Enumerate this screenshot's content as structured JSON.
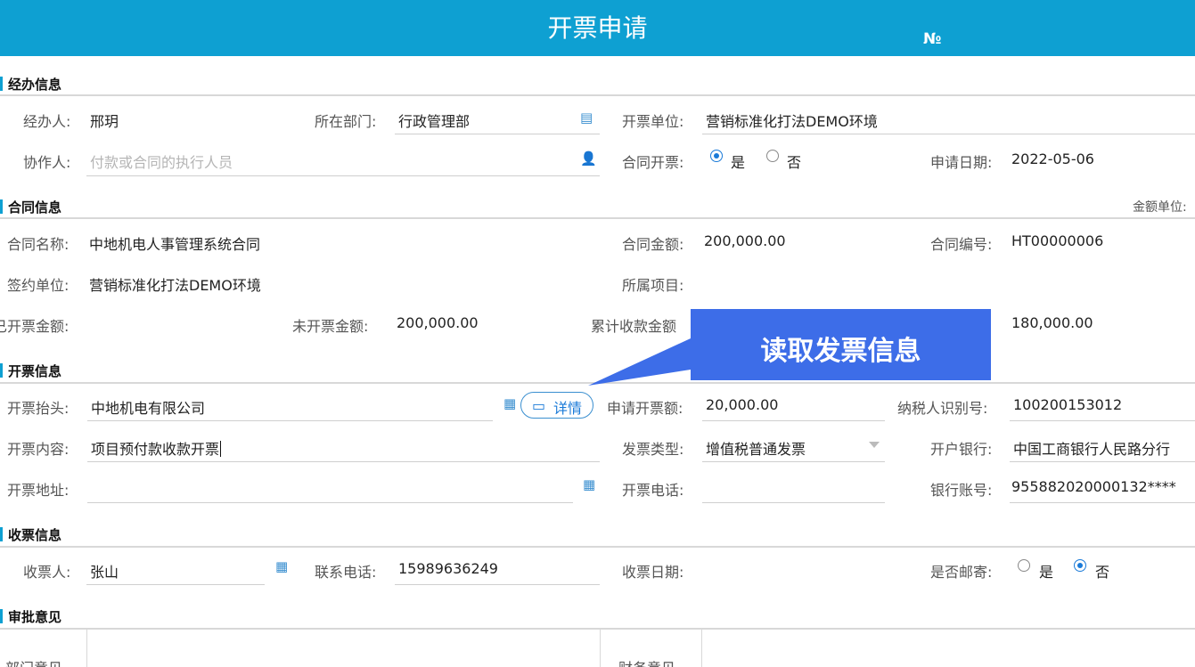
{
  "header": {
    "title": "开票申请",
    "no": "№"
  },
  "sections": {
    "handler": "经办信息",
    "contract": "合同信息",
    "invoice": "开票信息",
    "receive": "收票信息",
    "approval": "审批意见"
  },
  "handler": {
    "handler_label": "经办人:",
    "handler_value": "邢玥",
    "dept_label": "所在部门:",
    "dept_value": "行政管理部",
    "unit_label": "开票单位:",
    "unit_value": "营销标准化打法DEMO环境",
    "collab_label": "协作人:",
    "collab_placeholder": "付款或合同的执行人员",
    "contract_invoice_label": "合同开票:",
    "radio_yes": "是",
    "radio_no": "否",
    "apply_date_label": "申请日期:",
    "apply_date_value": "2022-05-06"
  },
  "contract": {
    "amount_unit_label": "金额单位:",
    "name_label": "合同名称:",
    "name_value": "中地机电人事管理系统合同",
    "amount_label": "合同金额:",
    "amount_value": "200,000.00",
    "code_label": "合同编号:",
    "code_value": "HT00000006",
    "sign_unit_label": "签约单位:",
    "sign_unit_value": "营销标准化打法DEMO环境",
    "project_label": "所属项目:",
    "invoiced_label": "已开票金额:",
    "uninvoiced_label": "未开票金额:",
    "uninvoiced_value": "200,000.00",
    "received_label": "累计收款金额",
    "received_value": "180,000.00"
  },
  "invoice": {
    "title_label": "开票抬头:",
    "title_value": "中地机电有限公司",
    "detail_button": "详情",
    "apply_amount_label": "申请开票额:",
    "apply_amount_value": "20,000.00",
    "taxpayer_label": "纳税人识别号:",
    "taxpayer_value": "100200153012",
    "content_label": "开票内容:",
    "content_value": "项目预付款收款开票",
    "type_label": "发票类型:",
    "type_value": "增值税普通发票",
    "bank_label": "开户银行:",
    "bank_value": "中国工商银行人民路分行",
    "address_label": "开票地址:",
    "phone_label": "开票电话:",
    "account_label": "银行账号:",
    "account_value": "955882020000132****"
  },
  "receive": {
    "receiver_label": "收票人:",
    "receiver_value": "张山",
    "contact_label": "联系电话:",
    "contact_value": "15989636249",
    "date_label": "收票日期:",
    "mail_label": "是否邮寄:",
    "radio_yes": "是",
    "radio_no": "否"
  },
  "approval": {
    "dept_opinion": "部门意见",
    "finance_opinion": "财务意见"
  },
  "callout": {
    "text": "读取发票信息"
  },
  "colors": {
    "header": "#0ea0d2",
    "callout": "#3d6de8",
    "accent": "#1a7ad8"
  }
}
